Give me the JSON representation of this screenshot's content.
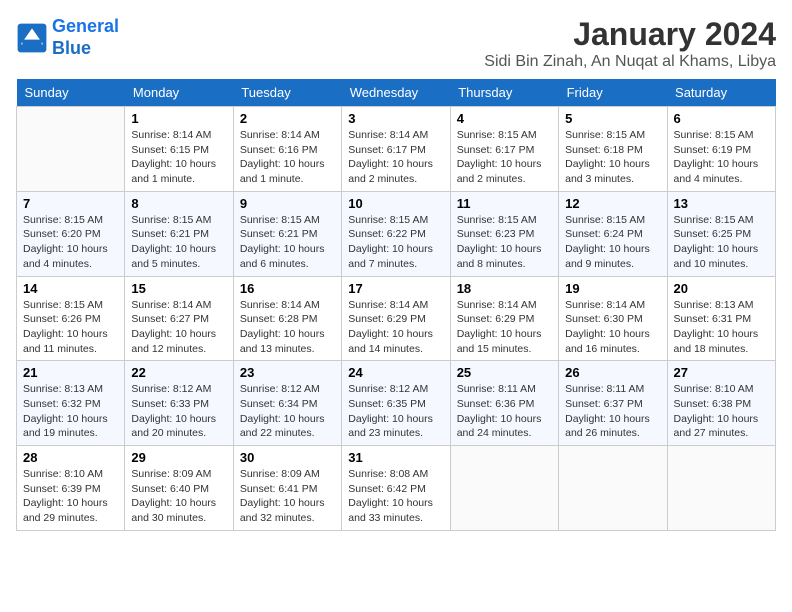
{
  "header": {
    "logo_line1": "General",
    "logo_line2": "Blue",
    "month": "January 2024",
    "location": "Sidi Bin Zinah, An Nuqat al Khams, Libya"
  },
  "days_of_week": [
    "Sunday",
    "Monday",
    "Tuesday",
    "Wednesday",
    "Thursday",
    "Friday",
    "Saturday"
  ],
  "weeks": [
    [
      {
        "num": "",
        "info": ""
      },
      {
        "num": "1",
        "info": "Sunrise: 8:14 AM\nSunset: 6:15 PM\nDaylight: 10 hours\nand 1 minute."
      },
      {
        "num": "2",
        "info": "Sunrise: 8:14 AM\nSunset: 6:16 PM\nDaylight: 10 hours\nand 1 minute."
      },
      {
        "num": "3",
        "info": "Sunrise: 8:14 AM\nSunset: 6:17 PM\nDaylight: 10 hours\nand 2 minutes."
      },
      {
        "num": "4",
        "info": "Sunrise: 8:15 AM\nSunset: 6:17 PM\nDaylight: 10 hours\nand 2 minutes."
      },
      {
        "num": "5",
        "info": "Sunrise: 8:15 AM\nSunset: 6:18 PM\nDaylight: 10 hours\nand 3 minutes."
      },
      {
        "num": "6",
        "info": "Sunrise: 8:15 AM\nSunset: 6:19 PM\nDaylight: 10 hours\nand 4 minutes."
      }
    ],
    [
      {
        "num": "7",
        "info": "Sunrise: 8:15 AM\nSunset: 6:20 PM\nDaylight: 10 hours\nand 4 minutes."
      },
      {
        "num": "8",
        "info": "Sunrise: 8:15 AM\nSunset: 6:21 PM\nDaylight: 10 hours\nand 5 minutes."
      },
      {
        "num": "9",
        "info": "Sunrise: 8:15 AM\nSunset: 6:21 PM\nDaylight: 10 hours\nand 6 minutes."
      },
      {
        "num": "10",
        "info": "Sunrise: 8:15 AM\nSunset: 6:22 PM\nDaylight: 10 hours\nand 7 minutes."
      },
      {
        "num": "11",
        "info": "Sunrise: 8:15 AM\nSunset: 6:23 PM\nDaylight: 10 hours\nand 8 minutes."
      },
      {
        "num": "12",
        "info": "Sunrise: 8:15 AM\nSunset: 6:24 PM\nDaylight: 10 hours\nand 9 minutes."
      },
      {
        "num": "13",
        "info": "Sunrise: 8:15 AM\nSunset: 6:25 PM\nDaylight: 10 hours\nand 10 minutes."
      }
    ],
    [
      {
        "num": "14",
        "info": "Sunrise: 8:15 AM\nSunset: 6:26 PM\nDaylight: 10 hours\nand 11 minutes."
      },
      {
        "num": "15",
        "info": "Sunrise: 8:14 AM\nSunset: 6:27 PM\nDaylight: 10 hours\nand 12 minutes."
      },
      {
        "num": "16",
        "info": "Sunrise: 8:14 AM\nSunset: 6:28 PM\nDaylight: 10 hours\nand 13 minutes."
      },
      {
        "num": "17",
        "info": "Sunrise: 8:14 AM\nSunset: 6:29 PM\nDaylight: 10 hours\nand 14 minutes."
      },
      {
        "num": "18",
        "info": "Sunrise: 8:14 AM\nSunset: 6:29 PM\nDaylight: 10 hours\nand 15 minutes."
      },
      {
        "num": "19",
        "info": "Sunrise: 8:14 AM\nSunset: 6:30 PM\nDaylight: 10 hours\nand 16 minutes."
      },
      {
        "num": "20",
        "info": "Sunrise: 8:13 AM\nSunset: 6:31 PM\nDaylight: 10 hours\nand 18 minutes."
      }
    ],
    [
      {
        "num": "21",
        "info": "Sunrise: 8:13 AM\nSunset: 6:32 PM\nDaylight: 10 hours\nand 19 minutes."
      },
      {
        "num": "22",
        "info": "Sunrise: 8:12 AM\nSunset: 6:33 PM\nDaylight: 10 hours\nand 20 minutes."
      },
      {
        "num": "23",
        "info": "Sunrise: 8:12 AM\nSunset: 6:34 PM\nDaylight: 10 hours\nand 22 minutes."
      },
      {
        "num": "24",
        "info": "Sunrise: 8:12 AM\nSunset: 6:35 PM\nDaylight: 10 hours\nand 23 minutes."
      },
      {
        "num": "25",
        "info": "Sunrise: 8:11 AM\nSunset: 6:36 PM\nDaylight: 10 hours\nand 24 minutes."
      },
      {
        "num": "26",
        "info": "Sunrise: 8:11 AM\nSunset: 6:37 PM\nDaylight: 10 hours\nand 26 minutes."
      },
      {
        "num": "27",
        "info": "Sunrise: 8:10 AM\nSunset: 6:38 PM\nDaylight: 10 hours\nand 27 minutes."
      }
    ],
    [
      {
        "num": "28",
        "info": "Sunrise: 8:10 AM\nSunset: 6:39 PM\nDaylight: 10 hours\nand 29 minutes."
      },
      {
        "num": "29",
        "info": "Sunrise: 8:09 AM\nSunset: 6:40 PM\nDaylight: 10 hours\nand 30 minutes."
      },
      {
        "num": "30",
        "info": "Sunrise: 8:09 AM\nSunset: 6:41 PM\nDaylight: 10 hours\nand 32 minutes."
      },
      {
        "num": "31",
        "info": "Sunrise: 8:08 AM\nSunset: 6:42 PM\nDaylight: 10 hours\nand 33 minutes."
      },
      {
        "num": "",
        "info": ""
      },
      {
        "num": "",
        "info": ""
      },
      {
        "num": "",
        "info": ""
      }
    ]
  ]
}
